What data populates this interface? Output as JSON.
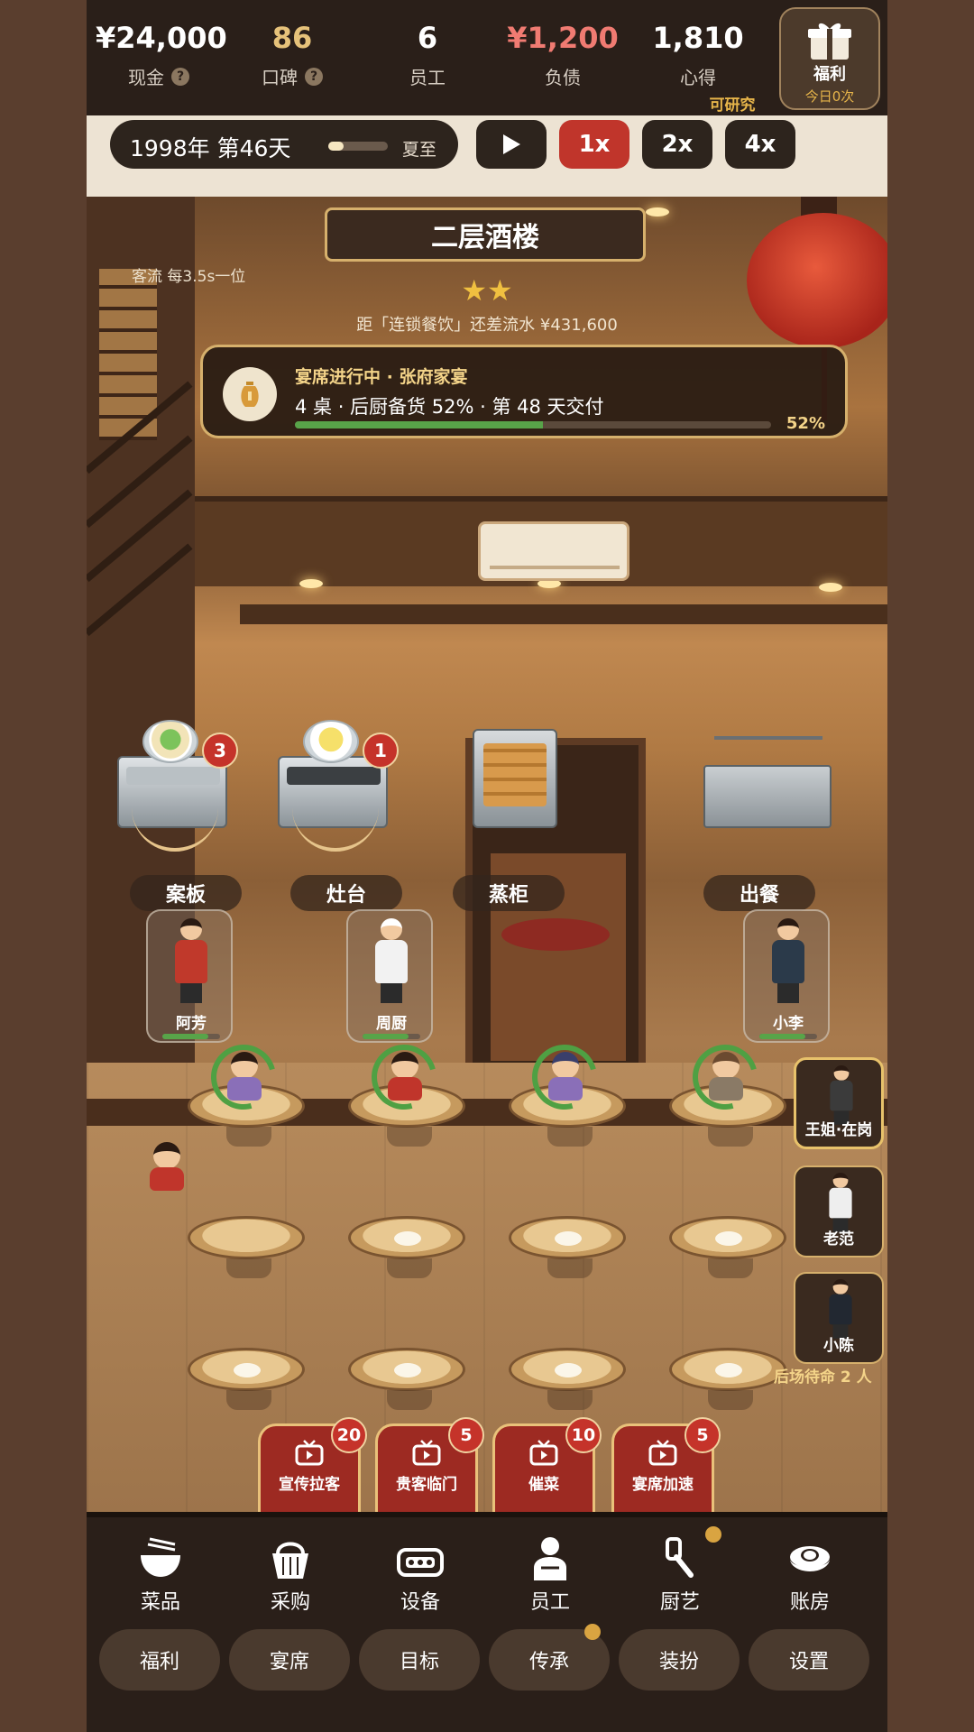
{
  "stats": [
    {
      "value": "¥24,000",
      "label": "现金",
      "help": true,
      "color": "#ffffff"
    },
    {
      "value": "86",
      "label": "口碑",
      "help": true,
      "color": "#e6c27a"
    },
    {
      "value": "6",
      "label": "员工",
      "help": false,
      "color": "#ffffff"
    },
    {
      "value": "¥1,200",
      "label": "负债",
      "help": false,
      "color": "#f07b72"
    },
    {
      "value": "1,810",
      "label": "心得",
      "help": false,
      "color": "#ffffff"
    }
  ],
  "research_hint": "可研究",
  "gift": {
    "label": "福利",
    "sub": "今日0次",
    "icon": "gift-icon"
  },
  "time": {
    "date": "1998年 第46天",
    "season": "夏至",
    "season_progress": 0.25
  },
  "speed": {
    "play_icon": "play-icon",
    "options": [
      "1x",
      "2x",
      "4x"
    ],
    "active": "1x"
  },
  "scene": {
    "title": "二层酒楼",
    "stars": "★★",
    "chain_text": "距「连锁餐饮」还差流水 ¥431,600",
    "flow_text": "客流 每3.5s一位"
  },
  "banquet": {
    "icon": "vase-icon",
    "title": "宴席进行中 · 张府家宴",
    "detail": "4 桌 · 后厨备货 52% · 第 48 天交付",
    "progress": 0.52,
    "percent_text": "52%"
  },
  "stations": [
    {
      "label": "案板",
      "badge": "3",
      "dish": "noodle-bowl-icon"
    },
    {
      "label": "灶台",
      "badge": "1",
      "dish": "fried-rice-icon"
    },
    {
      "label": "蒸柜",
      "badge": "",
      "dish": ""
    },
    {
      "label": "出餐",
      "badge": "",
      "dish": ""
    }
  ],
  "staff": [
    {
      "name": "阿芳",
      "role": "cook",
      "outfit": "#c0392b"
    },
    {
      "name": "周厨",
      "role": "chef",
      "outfit": "#f2f2f2"
    },
    {
      "name": "小李",
      "role": "server",
      "outfit": "#2b3a4a"
    }
  ],
  "waiters": [
    {
      "name": "王姐·在岗",
      "on_duty": true
    },
    {
      "name": "老范",
      "on_duty": false
    },
    {
      "name": "小陈",
      "on_duty": false
    }
  ],
  "standby_text": "后场待命 2 人",
  "customers": [
    {
      "shirt": "#8a6fb8"
    },
    {
      "shirt": "#c0352b"
    },
    {
      "shirt": "#8a6fb8"
    },
    {
      "shirt": "#8a7a66"
    }
  ],
  "actions": [
    {
      "label": "宣传拉客",
      "count": "20",
      "icon": "tv-icon"
    },
    {
      "label": "贵客临门",
      "count": "5",
      "icon": "tv-icon"
    },
    {
      "label": "催菜",
      "count": "10",
      "icon": "tv-icon"
    },
    {
      "label": "宴席加速",
      "count": "5",
      "icon": "tv-icon"
    }
  ],
  "nav": [
    {
      "label": "菜品",
      "icon": "bowl-icon",
      "dot": false
    },
    {
      "label": "采购",
      "icon": "basket-icon",
      "dot": false
    },
    {
      "label": "设备",
      "icon": "stove-icon",
      "dot": false
    },
    {
      "label": "员工",
      "icon": "person-icon",
      "dot": false
    },
    {
      "label": "厨艺",
      "icon": "ladle-icon",
      "dot": true
    },
    {
      "label": "账房",
      "icon": "ingot-icon",
      "dot": false
    }
  ],
  "pills": [
    {
      "label": "福利",
      "dot": false
    },
    {
      "label": "宴席",
      "dot": false
    },
    {
      "label": "目标",
      "dot": false
    },
    {
      "label": "传承",
      "dot": true
    },
    {
      "label": "装扮",
      "dot": false
    },
    {
      "label": "设置",
      "dot": false
    }
  ],
  "colors": {
    "accent": "#c0352b",
    "gold": "#d6b06c",
    "progress": "#58a449",
    "bg": "#2a1f19"
  }
}
